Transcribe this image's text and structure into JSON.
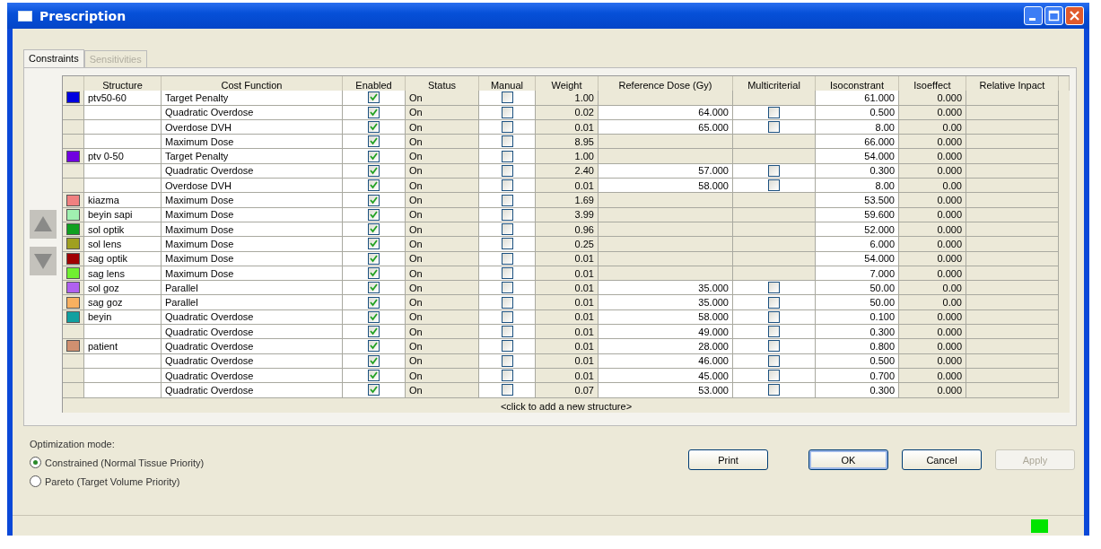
{
  "window": {
    "title": "Prescription"
  },
  "tabs": [
    {
      "label": "Constraints",
      "selected": true,
      "disabled": false
    },
    {
      "label": "Sensitivities",
      "selected": false,
      "disabled": true
    }
  ],
  "table": {
    "columns": [
      "Structure",
      "Cost Function",
      "Enabled",
      "Status",
      "Manual",
      "Weight",
      "Reference Dose (Gy)",
      "Multicriterial",
      "Isoconstrant",
      "Isoeffect",
      "Relative Inpact"
    ],
    "rows": [
      {
        "structure": "ptv50-60",
        "color": "#0000e0",
        "cost_function": "Target Penalty",
        "enabled": true,
        "status": "On",
        "manual": false,
        "weight": "1.00",
        "isoconstraint": "61.000",
        "isoeffect": "0.000"
      },
      {
        "cost_function": "Quadratic Overdose",
        "enabled": true,
        "status": "On",
        "manual": false,
        "weight": "0.02",
        "reference_dose": "64.000",
        "multicriterial": false,
        "isoconstraint": "0.500",
        "isoeffect": "0.000"
      },
      {
        "cost_function": "Overdose DVH",
        "enabled": true,
        "status": "On",
        "manual": false,
        "weight": "0.01",
        "reference_dose": "65.000",
        "multicriterial": false,
        "isoconstraint": "8.00",
        "isoeffect": "0.00"
      },
      {
        "cost_function": "Maximum Dose",
        "enabled": true,
        "status": "On",
        "manual": false,
        "weight": "8.95",
        "isoconstraint": "66.000",
        "isoeffect": "0.000"
      },
      {
        "structure": "ptv 0-50",
        "color": "#7000e0",
        "cost_function": "Target Penalty",
        "enabled": true,
        "status": "On",
        "manual": false,
        "weight": "1.00",
        "isoconstraint": "54.000",
        "isoeffect": "0.000"
      },
      {
        "cost_function": "Quadratic Overdose",
        "enabled": true,
        "status": "On",
        "manual": false,
        "weight": "2.40",
        "reference_dose": "57.000",
        "multicriterial": false,
        "isoconstraint": "0.300",
        "isoeffect": "0.000"
      },
      {
        "cost_function": "Overdose DVH",
        "enabled": true,
        "status": "On",
        "manual": false,
        "weight": "0.01",
        "reference_dose": "58.000",
        "multicriterial": false,
        "isoconstraint": "8.00",
        "isoeffect": "0.00"
      },
      {
        "structure": "kiazma",
        "color": "#f08080",
        "cost_function": "Maximum Dose",
        "enabled": true,
        "status": "On",
        "manual": false,
        "weight": "1.69",
        "isoconstraint": "53.500",
        "isoeffect": "0.000"
      },
      {
        "structure": "beyin sapi",
        "color": "#a0f0b0",
        "cost_function": "Maximum Dose",
        "enabled": true,
        "status": "On",
        "manual": false,
        "weight": "3.99",
        "isoconstraint": "59.600",
        "isoeffect": "0.000"
      },
      {
        "structure": "sol optik",
        "color": "#10a020",
        "cost_function": "Maximum Dose",
        "enabled": true,
        "status": "On",
        "manual": false,
        "weight": "0.96",
        "isoconstraint": "52.000",
        "isoeffect": "0.000"
      },
      {
        "structure": "sol lens",
        "color": "#a0a020",
        "cost_function": "Maximum Dose",
        "enabled": true,
        "status": "On",
        "manual": false,
        "weight": "0.25",
        "isoconstraint": "6.000",
        "isoeffect": "0.000"
      },
      {
        "structure": "sag optik",
        "color": "#a00000",
        "cost_function": "Maximum Dose",
        "enabled": true,
        "status": "On",
        "manual": false,
        "weight": "0.01",
        "isoconstraint": "54.000",
        "isoeffect": "0.000"
      },
      {
        "structure": "sag lens",
        "color": "#70f030",
        "cost_function": "Maximum Dose",
        "enabled": true,
        "status": "On",
        "manual": false,
        "weight": "0.01",
        "isoconstraint": "7.000",
        "isoeffect": "0.000"
      },
      {
        "structure": "sol goz",
        "color": "#b060f0",
        "cost_function": "Parallel",
        "enabled": true,
        "status": "On",
        "manual": false,
        "weight": "0.01",
        "reference_dose": "35.000",
        "multicriterial": false,
        "isoconstraint": "50.00",
        "isoeffect": "0.00"
      },
      {
        "structure": "sag goz",
        "color": "#f8b060",
        "cost_function": "Parallel",
        "enabled": true,
        "status": "On",
        "manual": false,
        "weight": "0.01",
        "reference_dose": "35.000",
        "multicriterial": false,
        "isoconstraint": "50.00",
        "isoeffect": "0.00"
      },
      {
        "structure": "beyin",
        "color": "#10a0a0",
        "cost_function": "Quadratic Overdose",
        "enabled": true,
        "status": "On",
        "manual": false,
        "weight": "0.01",
        "reference_dose": "58.000",
        "multicriterial": false,
        "isoconstraint": "0.100",
        "isoeffect": "0.000"
      },
      {
        "cost_function": "Quadratic Overdose",
        "enabled": true,
        "status": "On",
        "manual": false,
        "weight": "0.01",
        "reference_dose": "49.000",
        "multicriterial": false,
        "isoconstraint": "0.300",
        "isoeffect": "0.000"
      },
      {
        "structure": "patient",
        "color": "#d09070",
        "cost_function": "Quadratic Overdose",
        "enabled": true,
        "status": "On",
        "manual": false,
        "weight": "0.01",
        "reference_dose": "28.000",
        "multicriterial": false,
        "isoconstraint": "0.800",
        "isoeffect": "0.000"
      },
      {
        "cost_function": "Quadratic Overdose",
        "enabled": true,
        "status": "On",
        "manual": false,
        "weight": "0.01",
        "reference_dose": "46.000",
        "multicriterial": false,
        "isoconstraint": "0.500",
        "isoeffect": "0.000"
      },
      {
        "cost_function": "Quadratic Overdose",
        "enabled": true,
        "status": "On",
        "manual": false,
        "weight": "0.01",
        "reference_dose": "45.000",
        "multicriterial": false,
        "isoconstraint": "0.700",
        "isoeffect": "0.000"
      },
      {
        "cost_function": "Quadratic Overdose",
        "enabled": true,
        "status": "On",
        "manual": false,
        "weight": "0.07",
        "reference_dose": "53.000",
        "multicriterial": false,
        "isoconstraint": "0.300",
        "isoeffect": "0.000"
      }
    ],
    "add_row_hint": "<click to add a new structure>"
  },
  "optimization_mode": {
    "label": "Optimization mode:",
    "options": [
      {
        "label": "Constrained (Normal Tissue Priority)",
        "selected": true
      },
      {
        "label": "Pareto (Target Volume Priority)",
        "selected": false
      }
    ]
  },
  "buttons": [
    {
      "label": "Print",
      "default": false,
      "disabled": false
    },
    {
      "label": "OK",
      "default": true,
      "disabled": false
    },
    {
      "label": "Cancel",
      "default": false,
      "disabled": false
    },
    {
      "label": "Apply",
      "default": false,
      "disabled": true
    }
  ]
}
